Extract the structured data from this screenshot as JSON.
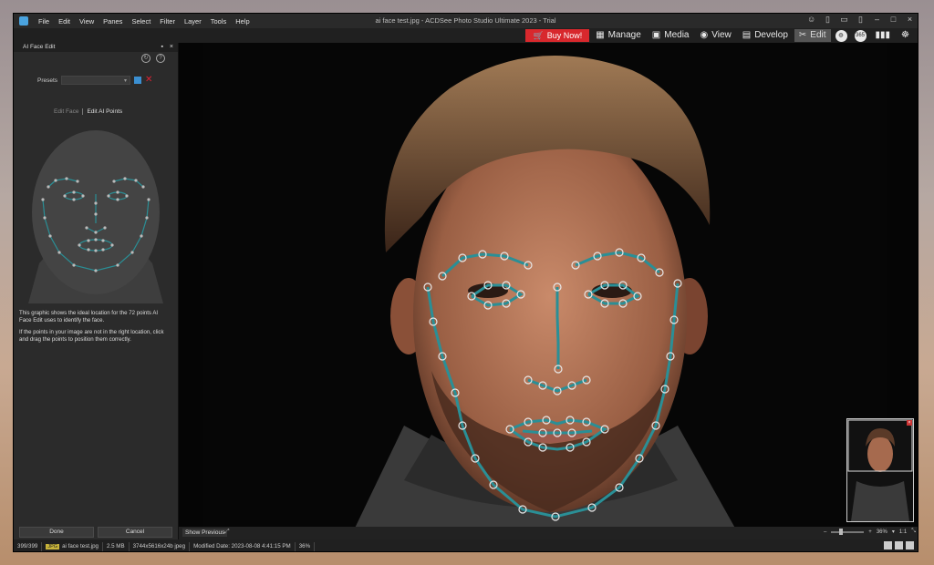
{
  "app": {
    "title": "ai face test.jpg - ACDSee Photo Studio Ultimate 2023 - Trial",
    "menu": [
      "File",
      "Edit",
      "View",
      "Panes",
      "Select",
      "Filter",
      "Layer",
      "Tools",
      "Help"
    ]
  },
  "modes": {
    "buy_now": "Buy Now!",
    "items": [
      {
        "label": "Manage",
        "icon": "grid-icon"
      },
      {
        "label": "Media",
        "icon": "media-icon"
      },
      {
        "label": "View",
        "icon": "eye-icon"
      },
      {
        "label": "Develop",
        "icon": "develop-icon"
      },
      {
        "label": "Edit",
        "icon": "edit-icon",
        "active": true
      }
    ],
    "badge_365": "365"
  },
  "panel": {
    "title": "AI Face Edit",
    "presets_label": "Presets",
    "presets_value": "",
    "tabs": [
      "Edit Face",
      "Edit AI Points"
    ],
    "selected_tab": "Edit AI Points",
    "info1": "This graphic shows the ideal location for the 72 points AI Face Edit uses to identify the face.",
    "info2": "If the points in your image are not in the right location, click and drag the points to position them correctly.",
    "done": "Done",
    "cancel": "Cancel"
  },
  "canvas": {
    "show_previous": "Show Previous",
    "zoom": "36%",
    "ratio": "1:1"
  },
  "status": {
    "count": "399/399",
    "type": "JPG",
    "filename": "ai face test.jpg",
    "size": "2.5 MB",
    "dims": "3744x5616x24b jpeg",
    "modified": "Modified Date: 2023-08-08 4:41:15 PM",
    "zoom": "36%"
  },
  "colors": {
    "accent": "#d8282d",
    "landmark": "#2a8f96",
    "panel": "#2b2b2b"
  }
}
